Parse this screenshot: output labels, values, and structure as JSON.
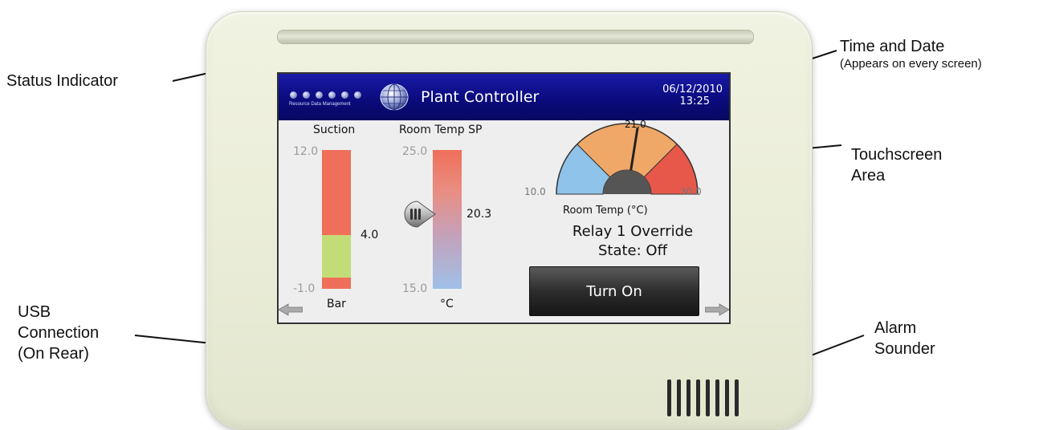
{
  "callouts": {
    "status_indicator": "Status Indicator",
    "time_date": "Time and Date",
    "time_date_sub": "(Appears on every screen)",
    "touchscreen_line1": "Touchscreen",
    "touchscreen_line2": "Area",
    "usb_line1": "USB",
    "usb_line2": "Connection",
    "usb_line3": "(On Rear)",
    "alarm_line1": "Alarm",
    "alarm_line2": "Sounder"
  },
  "screen": {
    "logo_text": "Resource Data Management",
    "title": "Plant Controller",
    "date": "06/12/2010",
    "time": "13:25",
    "suction": {
      "label": "Suction",
      "max": "12.0",
      "min": "-1.0",
      "value": "4.0",
      "unit": "Bar"
    },
    "room_temp_sp": {
      "label": "Room Temp SP",
      "max": "25.0",
      "min": "15.0",
      "value": "20.3",
      "unit": "°C"
    },
    "gauge": {
      "value": "21.0",
      "min": "10.0",
      "max": "30.0",
      "label": "Room Temp (°C)",
      "value_num": 21.0,
      "min_num": 10.0,
      "max_num": 30.0
    },
    "relay_title": "Relay 1 Override",
    "relay_state": "State: Off",
    "button_label": "Turn On"
  },
  "colors": {
    "header_blue": "#0b0b7e",
    "gauge_blue": "#8fc3ea",
    "gauge_orange": "#f0a868",
    "gauge_red": "#e8584a",
    "bar_red": "#ef6f5a",
    "bar_green": "#c2dc78"
  }
}
